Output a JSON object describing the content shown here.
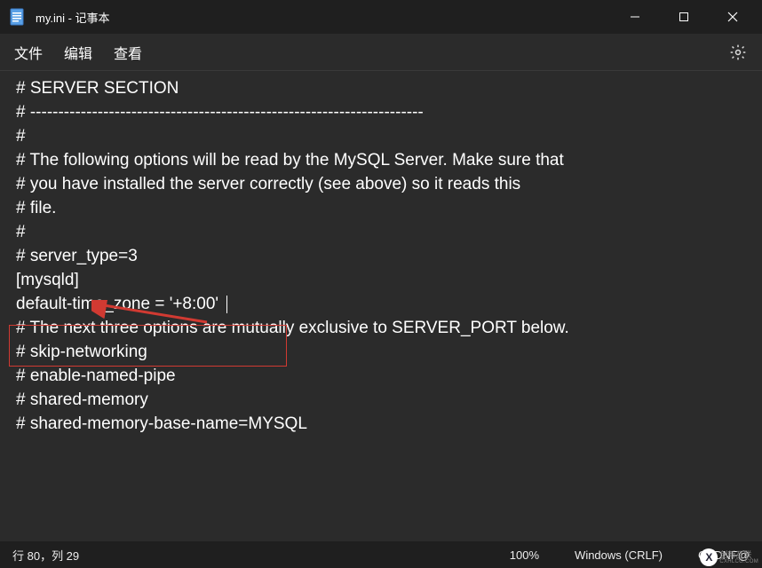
{
  "titlebar": {
    "title": "my.ini - 记事本"
  },
  "menubar": {
    "file": "文件",
    "edit": "编辑",
    "view": "查看"
  },
  "editor_lines": [
    "",
    "# SERVER SECTION",
    "# ----------------------------------------------------------------------",
    "#",
    "# The following options will be read by the MySQL Server. Make sure that",
    "# you have installed the server correctly (see above) so it reads this",
    "# file.",
    "#",
    "# server_type=3",
    "[mysqld]",
    "",
    "default-time_zone = '+8:00'",
    "",
    "# The next three options are mutually exclusive to SERVER_PORT below.",
    "# skip-networking",
    "# enable-named-pipe",
    "# shared-memory",
    "",
    "# shared-memory-base-name=MYSQL"
  ],
  "statusbar": {
    "cursor_pos": "行 80，列 29",
    "zoom": "100%",
    "line_ending": "Windows (CRLF)",
    "encoding_label": "CSDNF@"
  },
  "watermark": {
    "text": "创新互联",
    "sub": "CXHLCG.COM"
  }
}
